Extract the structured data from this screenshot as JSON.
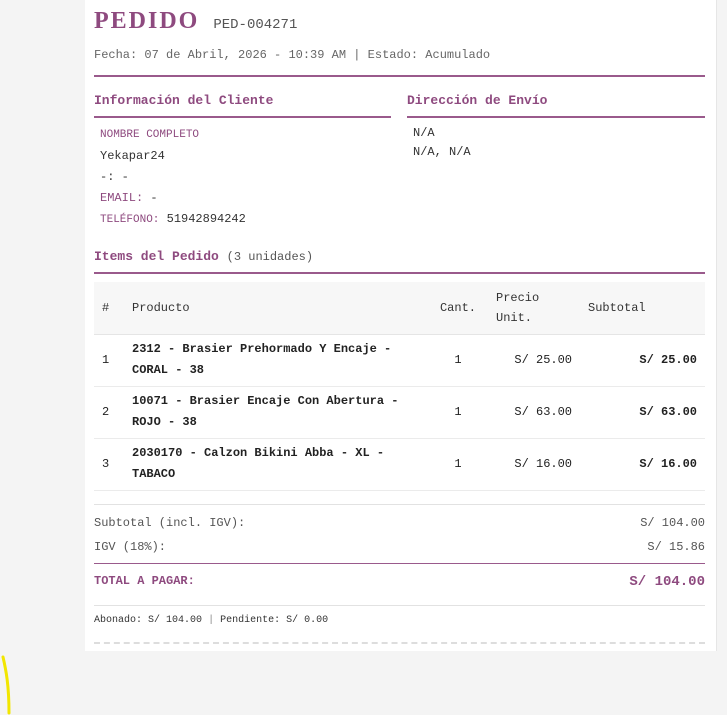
{
  "order": {
    "title": "PEDIDO",
    "code": "PED-004271",
    "meta_date_label": "Fecha:",
    "meta_date": "07 de Abril, 2026 - 10:39 AM",
    "meta_sep": "|",
    "meta_status_label": "Estado:",
    "meta_status": "Acumulado"
  },
  "client": {
    "heading": "Información del Cliente",
    "fullname_label": "NOMBRE COMPLETO",
    "fullname": "Yekapar24",
    "doc_label": "-:",
    "doc_value": "-",
    "email_label": "EMAIL:",
    "email_value": "-",
    "phone_label": "TELÉFONO:",
    "phone_value": "51942894242"
  },
  "shipping": {
    "heading": "Dirección de Envío",
    "line1": "N/A",
    "line2": "N/A, N/A"
  },
  "items": {
    "heading": "Items del Pedido",
    "count": "(3 unidades)",
    "columns": {
      "num": "#",
      "product": "Producto",
      "qty": "Cant.",
      "price_line1": "Precio",
      "price_line2": "Unit.",
      "subtotal": "Subtotal"
    },
    "rows": [
      {
        "num": "1",
        "product_line1": "2312 - Brasier Prehormado Y Encaje -",
        "product_line2": "CORAL - 38",
        "qty": "1",
        "price": "S/ 25.00",
        "subtotal": "S/ 25.00"
      },
      {
        "num": "2",
        "product_line1": "10071 - Brasier Encaje Con Abertura -",
        "product_line2": "ROJO - 38",
        "qty": "1",
        "price": "S/ 63.00",
        "subtotal": "S/ 63.00"
      },
      {
        "num": "3",
        "product_line1": "2030170 - Calzon Bikini Abba - XL -",
        "product_line2": "TABACO",
        "qty": "1",
        "price": "S/ 16.00",
        "subtotal": "S/ 16.00"
      }
    ]
  },
  "totals": {
    "subtotal_label": "Subtotal (incl. IGV):",
    "subtotal_value": "S/ 104.00",
    "igv_label": "IGV (18%):",
    "igv_value": "S/ 15.86",
    "total_label": "TOTAL A PAGAR:",
    "total_value": "S/ 104.00"
  },
  "payment": {
    "paid_label": "Abonado:",
    "paid_value": "S/ 104.00",
    "sep": "|",
    "pending_label": "Pendiente:",
    "pending_value": "S/ 0.00"
  },
  "colors": {
    "accent": "#8e4a7f",
    "rule": "#9a5a8c",
    "highlight": "#f2e600"
  }
}
